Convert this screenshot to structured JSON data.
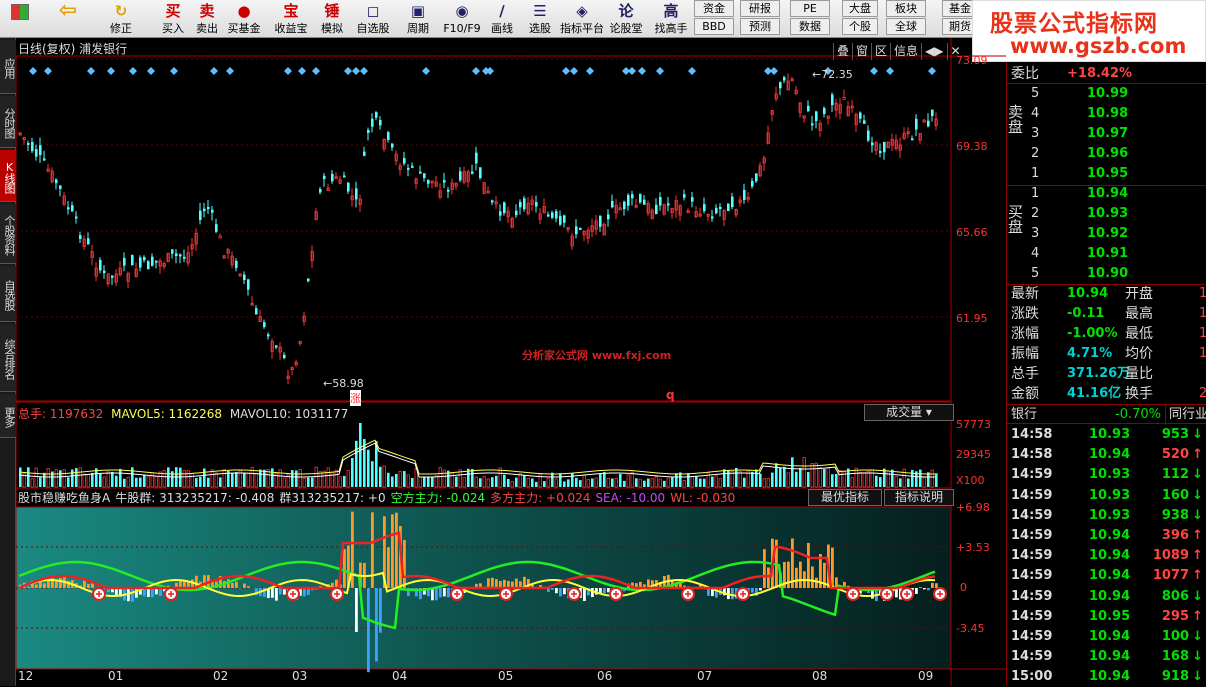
{
  "toolbar": {
    "buttons": [
      {
        "label": "",
        "icon": "grid-icon"
      },
      {
        "label": "",
        "icon": "back-arrow-icon"
      },
      {
        "label": "修正",
        "icon": "refresh-icon"
      },
      {
        "label": "买入",
        "icon_text": "买"
      },
      {
        "label": "卖出",
        "icon_text": "卖"
      },
      {
        "label": "买基金",
        "icon_text": "●"
      },
      {
        "label": "收益宝",
        "icon_text": "宝"
      },
      {
        "label": "模拟",
        "icon_text": "锤"
      },
      {
        "label": "自选股",
        "icon_text": "◻"
      },
      {
        "label": "周期",
        "icon_text": "▣"
      },
      {
        "label": "F10/F9",
        "icon_text": "◉"
      },
      {
        "label": "画线",
        "icon_text": "∕"
      },
      {
        "label": "选股",
        "icon_text": "☰"
      },
      {
        "label": "指标平台",
        "icon_text": "◈"
      },
      {
        "label": "论股堂",
        "icon_text": "论"
      },
      {
        "label": "找高手",
        "icon_text": "高"
      }
    ],
    "small": [
      "资金",
      "研报",
      "BBD",
      "预测",
      "PE",
      "数据",
      "大盘",
      "板块",
      "个股",
      "全球",
      "基金",
      "期货"
    ]
  },
  "watermark": {
    "line1": "股票公式指标网",
    "line2": "www.gszb.com"
  },
  "left_tabs": [
    "应用",
    "分时图",
    "K线图",
    "个股资料",
    "自选股",
    "综合排名",
    "更多"
  ],
  "chart": {
    "title": "日线(复权) 浦发银行",
    "top_buttons": [
      "叠",
      "窗",
      "区",
      "信息"
    ],
    "price_ticks": [
      "73.09",
      "69.38",
      "65.66",
      "61.95"
    ],
    "high_label": "72.35",
    "low_label": "58.98",
    "low_marker": "涨",
    "q_marker": "q",
    "center_watermark": "分析家公式网 www.fxj.com",
    "volume": {
      "label_total": "总手: 1197632",
      "label_mavol5": "MAVOL5: 1162268",
      "label_mavol10": "MAVOL10: 1031177",
      "dropdown": "成交量",
      "ticks": [
        "57773",
        "29345",
        "X100"
      ]
    },
    "indicator": {
      "name": "股市稳赚吃鱼身A",
      "items": [
        {
          "text": "牛股群: 313235217: -0.408",
          "color": "#dddddd"
        },
        {
          "text": "群313235217: +0",
          "color": "#dddddd"
        },
        {
          "text": "空方主力: -0.024",
          "color": "#33ff33"
        },
        {
          "text": "多方主力: +0.024",
          "color": "#ff4444"
        },
        {
          "text": "SEA: -10.00",
          "color": "#cc44ff"
        },
        {
          "text": "WL: -0.030",
          "color": "#ff4444"
        }
      ],
      "btn_best": "最优指标",
      "btn_help": "指标说明",
      "ticks": [
        "+6.98",
        "+3.53",
        "0",
        "-3.45"
      ]
    },
    "x_ticks": [
      "12",
      "01",
      "02",
      "03",
      "04",
      "05",
      "06",
      "07",
      "08",
      "09"
    ]
  },
  "quote": {
    "weibi_label": "委比",
    "weibi_value": "+18.42%",
    "sell_label": "卖盘",
    "buy_label": "买盘",
    "sell": [
      {
        "lvl": "5",
        "price": "10.99"
      },
      {
        "lvl": "4",
        "price": "10.98"
      },
      {
        "lvl": "3",
        "price": "10.97"
      },
      {
        "lvl": "2",
        "price": "10.96"
      },
      {
        "lvl": "1",
        "price": "10.95"
      }
    ],
    "buy": [
      {
        "lvl": "1",
        "price": "10.94"
      },
      {
        "lvl": "2",
        "price": "10.93"
      },
      {
        "lvl": "3",
        "price": "10.92"
      },
      {
        "lvl": "4",
        "price": "10.91"
      },
      {
        "lvl": "5",
        "price": "10.90"
      }
    ],
    "stats": [
      {
        "k": "最新",
        "v": "10.94",
        "k2": "开盘",
        "v2": "1",
        "vc": "grn"
      },
      {
        "k": "涨跌",
        "v": "-0.11",
        "k2": "最高",
        "v2": "1",
        "vc": "grn"
      },
      {
        "k": "涨幅",
        "v": "-1.00%",
        "k2": "最低",
        "v2": "1",
        "vc": "grn"
      },
      {
        "k": "振幅",
        "v": "4.71%",
        "k2": "均价",
        "v2": "1",
        "vc": "cyan"
      },
      {
        "k": "总手",
        "v": "371.26万",
        "k2": "量比",
        "v2": "",
        "vc": "cyan"
      },
      {
        "k": "金额",
        "v": "41.16亿",
        "k2": "换手",
        "v2": "2",
        "vc": "cyan"
      }
    ],
    "sector": "银行",
    "sector_change": "-0.70%",
    "sector_btn": "同行业",
    "ticks": [
      {
        "t": "14:58",
        "p": "10.93",
        "v": "953",
        "d": "down"
      },
      {
        "t": "14:58",
        "p": "10.94",
        "v": "520",
        "d": "up"
      },
      {
        "t": "14:59",
        "p": "10.93",
        "v": "112",
        "d": "down"
      },
      {
        "t": "14:59",
        "p": "10.93",
        "v": "160",
        "d": "down"
      },
      {
        "t": "14:59",
        "p": "10.93",
        "v": "938",
        "d": "down"
      },
      {
        "t": "14:59",
        "p": "10.94",
        "v": "396",
        "d": "up"
      },
      {
        "t": "14:59",
        "p": "10.94",
        "v": "1089",
        "d": "up"
      },
      {
        "t": "14:59",
        "p": "10.94",
        "v": "1077",
        "d": "up"
      },
      {
        "t": "14:59",
        "p": "10.94",
        "v": "806",
        "d": "down"
      },
      {
        "t": "14:59",
        "p": "10.95",
        "v": "295",
        "d": "up"
      },
      {
        "t": "14:59",
        "p": "10.94",
        "v": "100",
        "d": "down"
      },
      {
        "t": "14:59",
        "p": "10.94",
        "v": "168",
        "d": "down"
      },
      {
        "t": "15:00",
        "p": "10.94",
        "v": "918",
        "d": "down"
      }
    ]
  },
  "colors": {
    "up": "#ff3333",
    "down": "#54ffff",
    "frame": "#aa0000"
  }
}
